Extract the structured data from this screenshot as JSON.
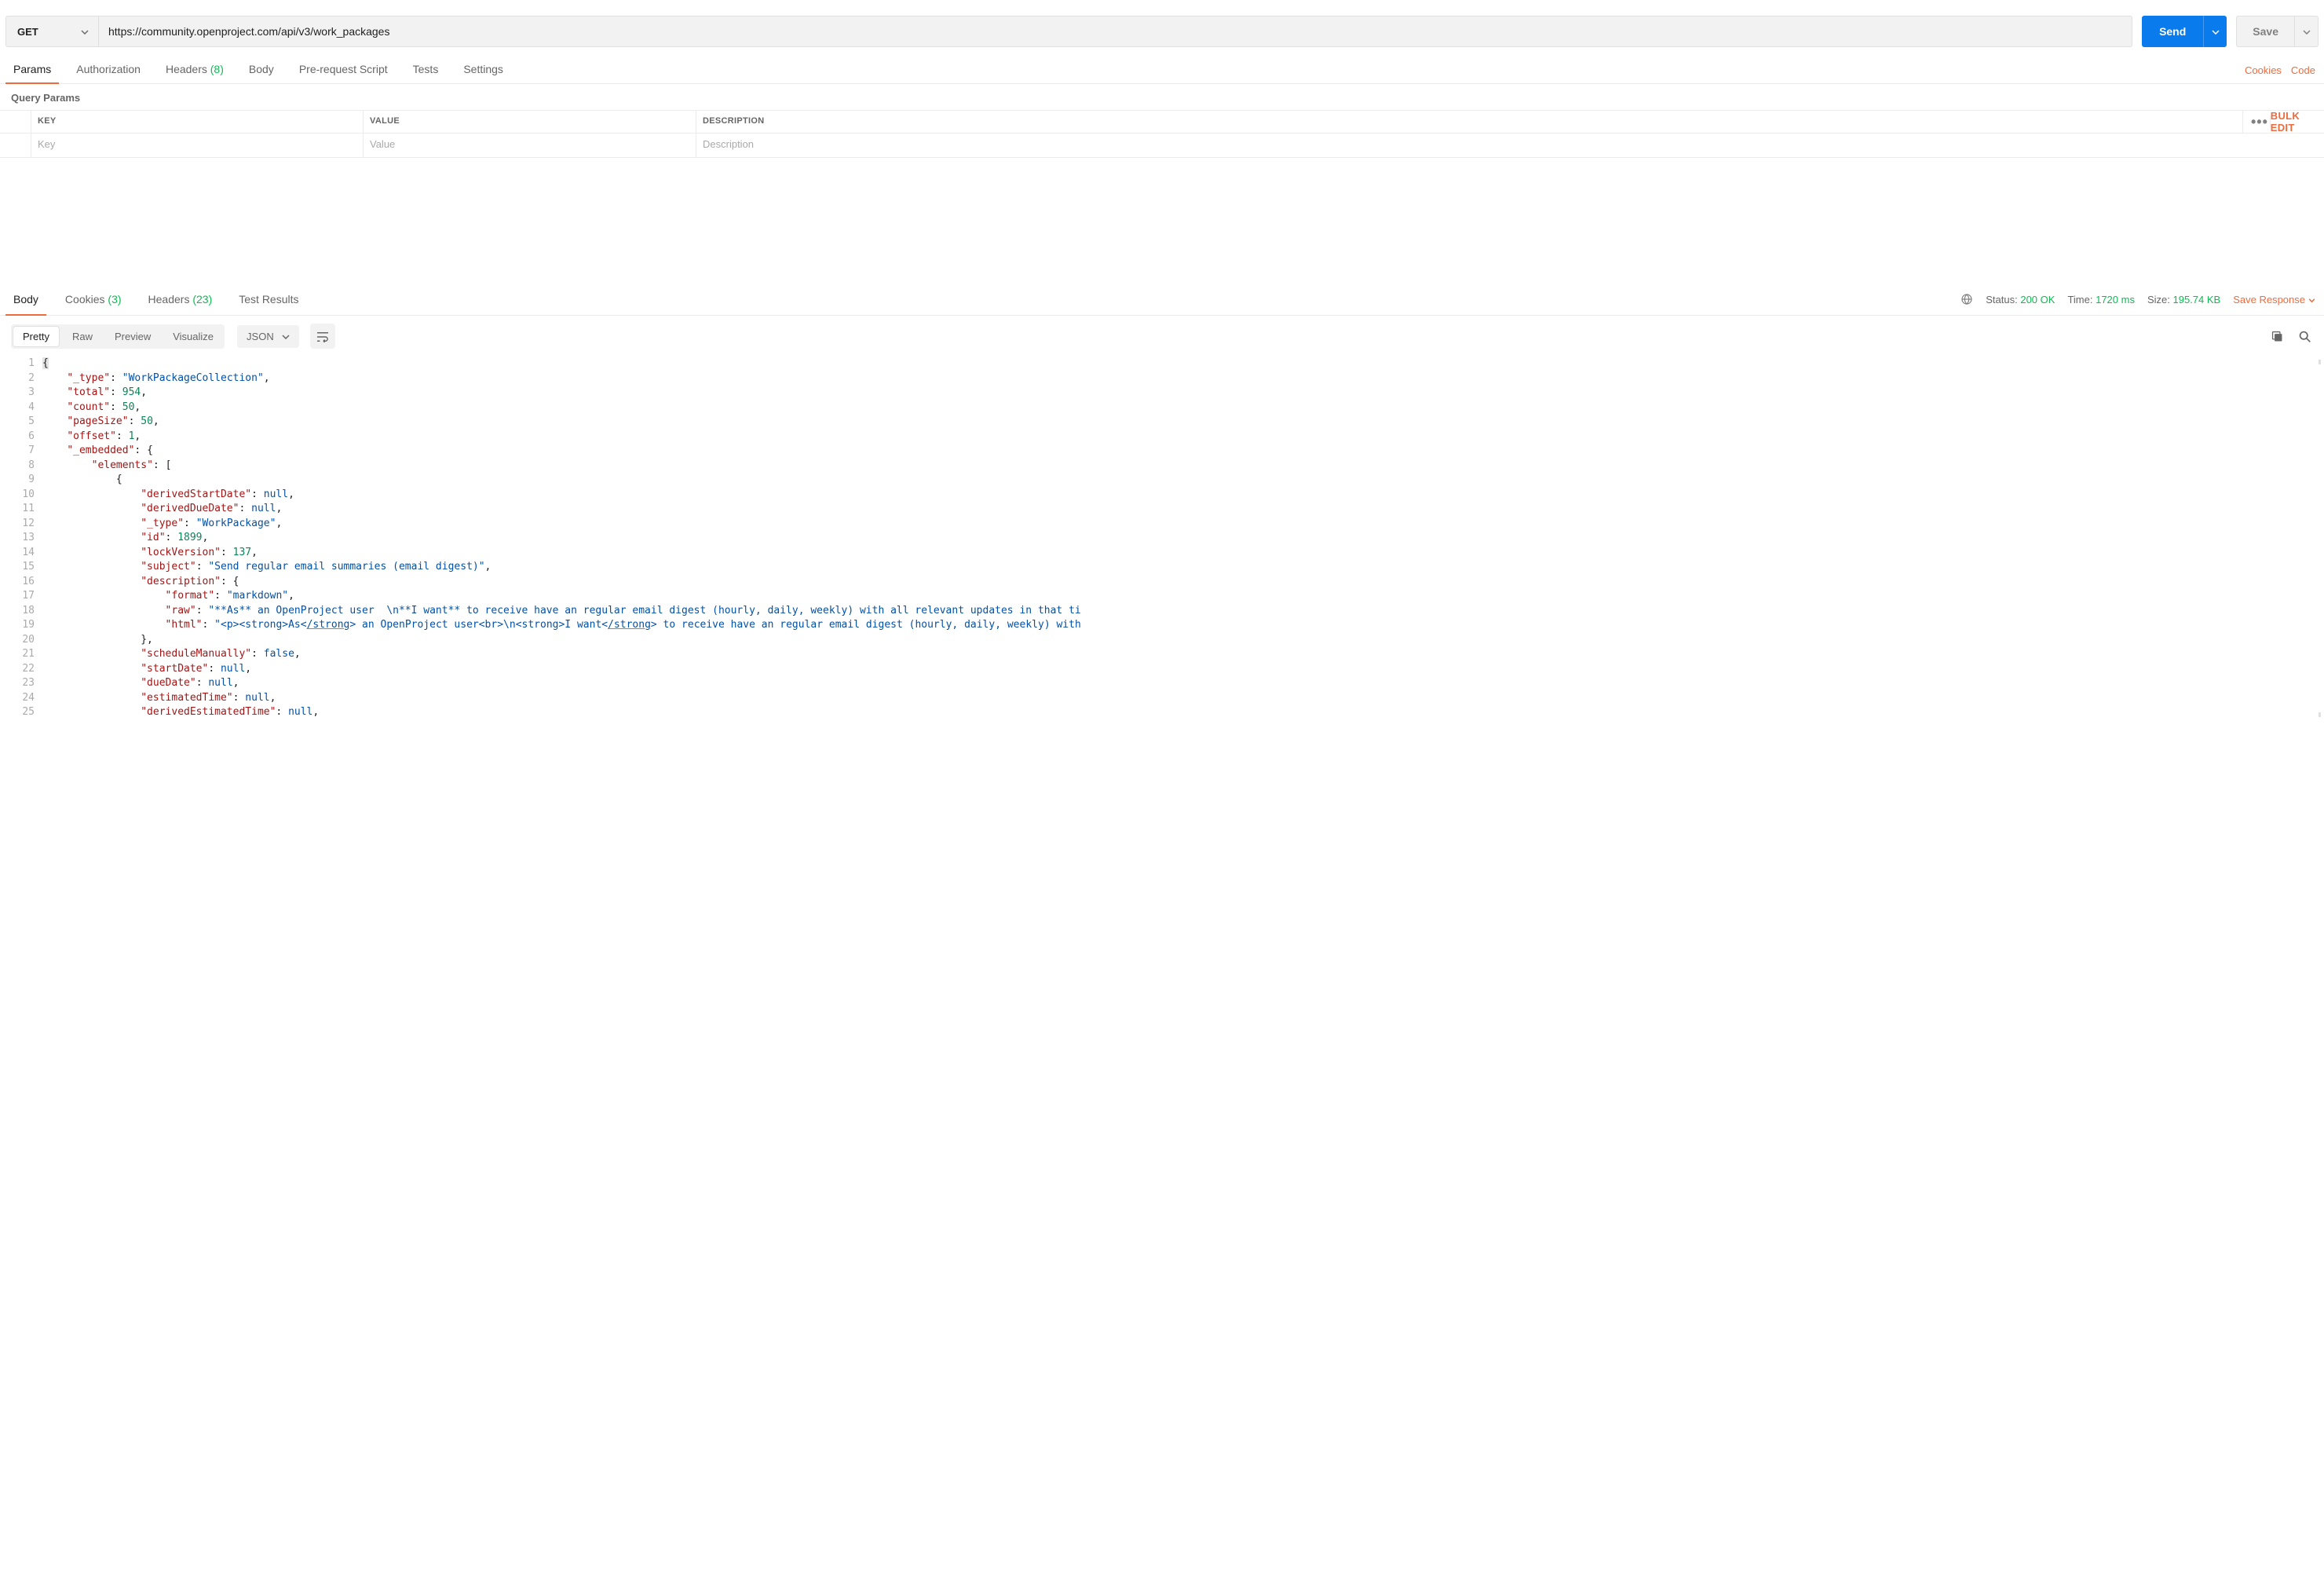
{
  "request": {
    "method": "GET",
    "url": "https://community.openproject.com/api/v3/work_packages",
    "send_label": "Send",
    "save_label": "Save"
  },
  "request_tabs": {
    "params": "Params",
    "authorization": "Authorization",
    "headers": "Headers",
    "headers_count": "(8)",
    "body": "Body",
    "prerequest": "Pre-request Script",
    "tests": "Tests",
    "settings": "Settings",
    "cookies": "Cookies",
    "code": "Code"
  },
  "query_params": {
    "section_label": "Query Params",
    "headers": {
      "key": "KEY",
      "value": "VALUE",
      "description": "DESCRIPTION"
    },
    "placeholders": {
      "key": "Key",
      "value": "Value",
      "description": "Description"
    },
    "bulk_edit": "Bulk Edit"
  },
  "response_tabs": {
    "body": "Body",
    "cookies": "Cookies",
    "cookies_count": "(3)",
    "headers": "Headers",
    "headers_count": "(23)",
    "test_results": "Test Results"
  },
  "response_meta": {
    "status_label": "Status:",
    "status_value": "200 OK",
    "time_label": "Time:",
    "time_value": "1720 ms",
    "size_label": "Size:",
    "size_value": "195.74 KB",
    "save_response": "Save Response"
  },
  "response_toolbar": {
    "pretty": "Pretty",
    "raw": "Raw",
    "preview": "Preview",
    "visualize": "Visualize",
    "format": "JSON"
  },
  "code_lines": [
    {
      "n": 1,
      "raw": "{",
      "hl": true
    },
    {
      "n": 2,
      "raw": "    \"_type\": \"WorkPackageCollection\","
    },
    {
      "n": 3,
      "raw": "    \"total\": 954,"
    },
    {
      "n": 4,
      "raw": "    \"count\": 50,"
    },
    {
      "n": 5,
      "raw": "    \"pageSize\": 50,"
    },
    {
      "n": 6,
      "raw": "    \"offset\": 1,"
    },
    {
      "n": 7,
      "raw": "    \"_embedded\": {"
    },
    {
      "n": 8,
      "raw": "        \"elements\": ["
    },
    {
      "n": 9,
      "raw": "            {"
    },
    {
      "n": 10,
      "raw": "                \"derivedStartDate\": null,"
    },
    {
      "n": 11,
      "raw": "                \"derivedDueDate\": null,"
    },
    {
      "n": 12,
      "raw": "                \"_type\": \"WorkPackage\","
    },
    {
      "n": 13,
      "raw": "                \"id\": 1899,"
    },
    {
      "n": 14,
      "raw": "                \"lockVersion\": 137,"
    },
    {
      "n": 15,
      "raw": "                \"subject\": \"Send regular email summaries (email digest)\","
    },
    {
      "n": 16,
      "raw": "                \"description\": {"
    },
    {
      "n": 17,
      "raw": "                    \"format\": \"markdown\","
    },
    {
      "n": 18,
      "raw": "                    \"raw\": \"**As** an OpenProject user  \\n**I want** to receive have an regular email digest (hourly, daily, weekly) with all relevant updates in that ti"
    },
    {
      "n": 19,
      "raw": "                    \"html\": \"<p><strong>As</strong> an OpenProject user<br>\\n<strong>I want</strong> to receive have an regular email digest (hourly, daily, weekly) with"
    },
    {
      "n": 20,
      "raw": "                },"
    },
    {
      "n": 21,
      "raw": "                \"scheduleManually\": false,"
    },
    {
      "n": 22,
      "raw": "                \"startDate\": null,"
    },
    {
      "n": 23,
      "raw": "                \"dueDate\": null,"
    },
    {
      "n": 24,
      "raw": "                \"estimatedTime\": null,"
    },
    {
      "n": 25,
      "raw": "                \"derivedEstimatedTime\": null,"
    }
  ]
}
